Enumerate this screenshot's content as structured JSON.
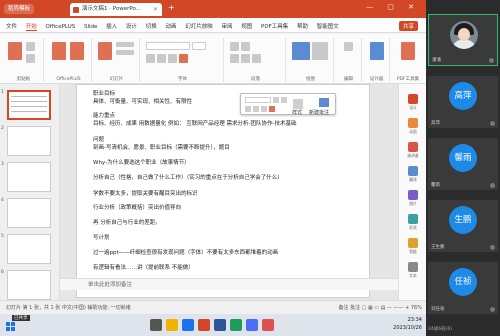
{
  "window": {
    "app_pill": "稻壳模板",
    "doc_tab": "演示文稿1 · PowerPo...",
    "new_tab": "+",
    "window_controls": "— ▢ ✕",
    "tab_close": "✕"
  },
  "menubar": {
    "items": [
      "文件",
      "开始",
      "OfficePLUS",
      "Slide",
      "插入",
      "设计",
      "切换",
      "动画",
      "幻灯片放映",
      "审阅",
      "视图",
      "PDF工具集",
      "帮助",
      "智能图文"
    ],
    "active_index": 1,
    "share_label": "共享"
  },
  "ribbon": {
    "groups": [
      "剪贴板",
      "OfficePLUS",
      "幻灯片",
      "字体",
      "段落",
      "绘图",
      "编辑",
      "设计器",
      "PDF工具集"
    ]
  },
  "slide_numbers": [
    "1",
    "2",
    "3",
    "4",
    "5",
    "6"
  ],
  "slide_lines": [
    "职业目标",
    "具体、可衡量、可实现、相关性、有限性",
    "能力重点",
    "目标、经历、成果 用数据量化  例如：  互联网产品经理  需求分析-团队协作-技术基础",
    "问题",
    "刻画-写清机会、愿景、职业目标（需要不断提升），题目",
    "Why-为什么要选这个职业（故事情节）",
    "分析自己（性格、自己做了什么工作）（实习的重点在于分析自己学会了什么）",
    "学数不要太多，提取关要有醒目突出的标识",
    "行业分析（政策概括）突出价值导向",
    "再 分析自己与行业的差距。",
    "写计划",
    "过一遍ppt——纤细检查很有发现问题（字体）不要有太多东西都堆着的动画",
    "有逻辑有看法……讲（提前联系 不能做）"
  ],
  "floatbar": {
    "style_label": "样式",
    "new_comment_label": "新建批注"
  },
  "right_pane": {
    "items": [
      "设计",
      "动画",
      "演讲者",
      "翻译",
      "图片",
      "形状",
      "智能",
      "文本"
    ]
  },
  "notes_placeholder": "单击此处添加备注",
  "status": {
    "left": "幻灯片 第 1 张，共 1 张   中文(中国)   辅助功能: 一切就绪",
    "right": "备注   批注   ▢ ▦ ▭ ▤   —  —— +   76%"
  },
  "taskbar": {
    "corner_badge": "已共享",
    "time": "23:34",
    "date": "2023/10/26"
  },
  "participants": [
    {
      "name": "潘潘",
      "avatar_text": "",
      "is_photo": true,
      "active": true
    },
    {
      "name": "高萍",
      "avatar_text": "高萍",
      "is_photo": false,
      "active": false
    },
    {
      "name": "馨雨",
      "avatar_text": "馨雨",
      "is_photo": false,
      "active": false
    },
    {
      "name": "生鹏",
      "avatar_text": "生鹏",
      "is_photo": false,
      "active": false
    },
    {
      "name": "任祯",
      "avatar_text": "任祯",
      "is_photo": false,
      "active": false
    }
  ],
  "participant_labels": [
    "潘潘",
    "高萍",
    "馨雨",
    "王生鹏",
    "刘任祯"
  ],
  "people_footer": "24级6班(6)",
  "colors": {
    "ppt_red": "#d24726",
    "avatar_blue": "#1d8ae8",
    "active_green": "#2dbd6e"
  }
}
